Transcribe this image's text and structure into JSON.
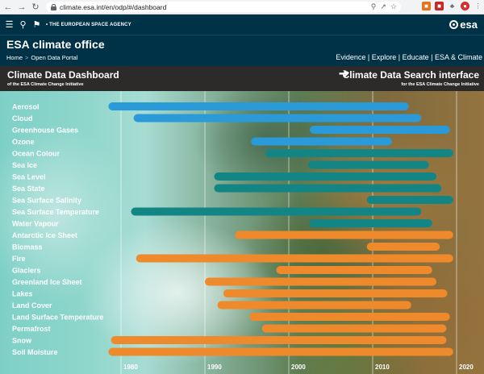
{
  "browser": {
    "url": "climate.esa.int/en/odp/#/dashboard"
  },
  "esa_bar": {
    "agency": "• THE EUROPEAN SPACE AGENCY",
    "logo": "esa"
  },
  "office": {
    "title": "ESA climate office",
    "breadcrumb_home": "Home",
    "breadcrumb_separator": ">",
    "breadcrumb_current": "Open Data Portal",
    "nav_links": "Evidence | Explore | Educate | ESA & Climate"
  },
  "dashboard": {
    "title": "Climate Data Dashboard",
    "subtitle": "of the ESA Climate Change Initiative",
    "search_title": "Climate Data Search interface",
    "search_subtitle": "for the ESA Climate Change Initiative"
  },
  "colors": {
    "atmosphere": "#2a9ad8",
    "ocean": "#138585",
    "land": "#ee8a2c"
  },
  "chart_data": {
    "type": "bar",
    "orientation": "horizontal-range",
    "x_ticks": [
      "1980",
      "1990",
      "2000",
      "2010",
      "2020"
    ],
    "x_range": [
      1976,
      2023
    ],
    "grid": true,
    "series": [
      {
        "label": "Aerosol",
        "start": 1978.5,
        "end": 2014.3,
        "group": "atmosphere"
      },
      {
        "label": "Cloud",
        "start": 1981.5,
        "end": 2015.8,
        "group": "atmosphere"
      },
      {
        "label": "Greenhouse Gases",
        "start": 2002.5,
        "end": 2019.2,
        "group": "atmosphere"
      },
      {
        "label": "Ozone",
        "start": 1995.5,
        "end": 2012.3,
        "group": "atmosphere"
      },
      {
        "label": "Ocean Colour",
        "start": 1997.2,
        "end": 2019.6,
        "group": "ocean"
      },
      {
        "label": "Sea Ice",
        "start": 2002.3,
        "end": 2016.7,
        "group": "ocean"
      },
      {
        "label": "Sea Level",
        "start": 1991.1,
        "end": 2017.6,
        "group": "ocean"
      },
      {
        "label": "Sea State",
        "start": 1991.1,
        "end": 2018.2,
        "group": "ocean"
      },
      {
        "label": "Sea Surface Salinity",
        "start": 2009.3,
        "end": 2019.6,
        "group": "ocean"
      },
      {
        "label": "Sea Surface Temperature",
        "start": 1981.2,
        "end": 2015.8,
        "group": "ocean"
      },
      {
        "label": "Water Vapour",
        "start": 2002.4,
        "end": 2017.1,
        "group": "ocean"
      },
      {
        "label": "Antarctic Ice Sheet",
        "start": 1993.6,
        "end": 2019.6,
        "group": "land"
      },
      {
        "label": "Biomass",
        "start": 2009.3,
        "end": 2018.0,
        "group": "land"
      },
      {
        "label": "Fire",
        "start": 1981.8,
        "end": 2019.6,
        "group": "land"
      },
      {
        "label": "Glaciers",
        "start": 1998.5,
        "end": 2017.1,
        "group": "land"
      },
      {
        "label": "Greenland Ice Sheet",
        "start": 1990.0,
        "end": 2017.6,
        "group": "land"
      },
      {
        "label": "Lakes",
        "start": 1992.2,
        "end": 2018.9,
        "group": "land"
      },
      {
        "label": "Land Cover",
        "start": 1991.5,
        "end": 2014.6,
        "group": "land"
      },
      {
        "label": "Land Surface Temperature",
        "start": 1995.3,
        "end": 2019.2,
        "group": "land"
      },
      {
        "label": "Permafrost",
        "start": 1996.8,
        "end": 2018.8,
        "group": "land"
      },
      {
        "label": "Snow",
        "start": 1978.8,
        "end": 2018.8,
        "group": "land"
      },
      {
        "label": "Soil Moisture",
        "start": 1978.5,
        "end": 2019.6,
        "group": "land"
      }
    ]
  }
}
